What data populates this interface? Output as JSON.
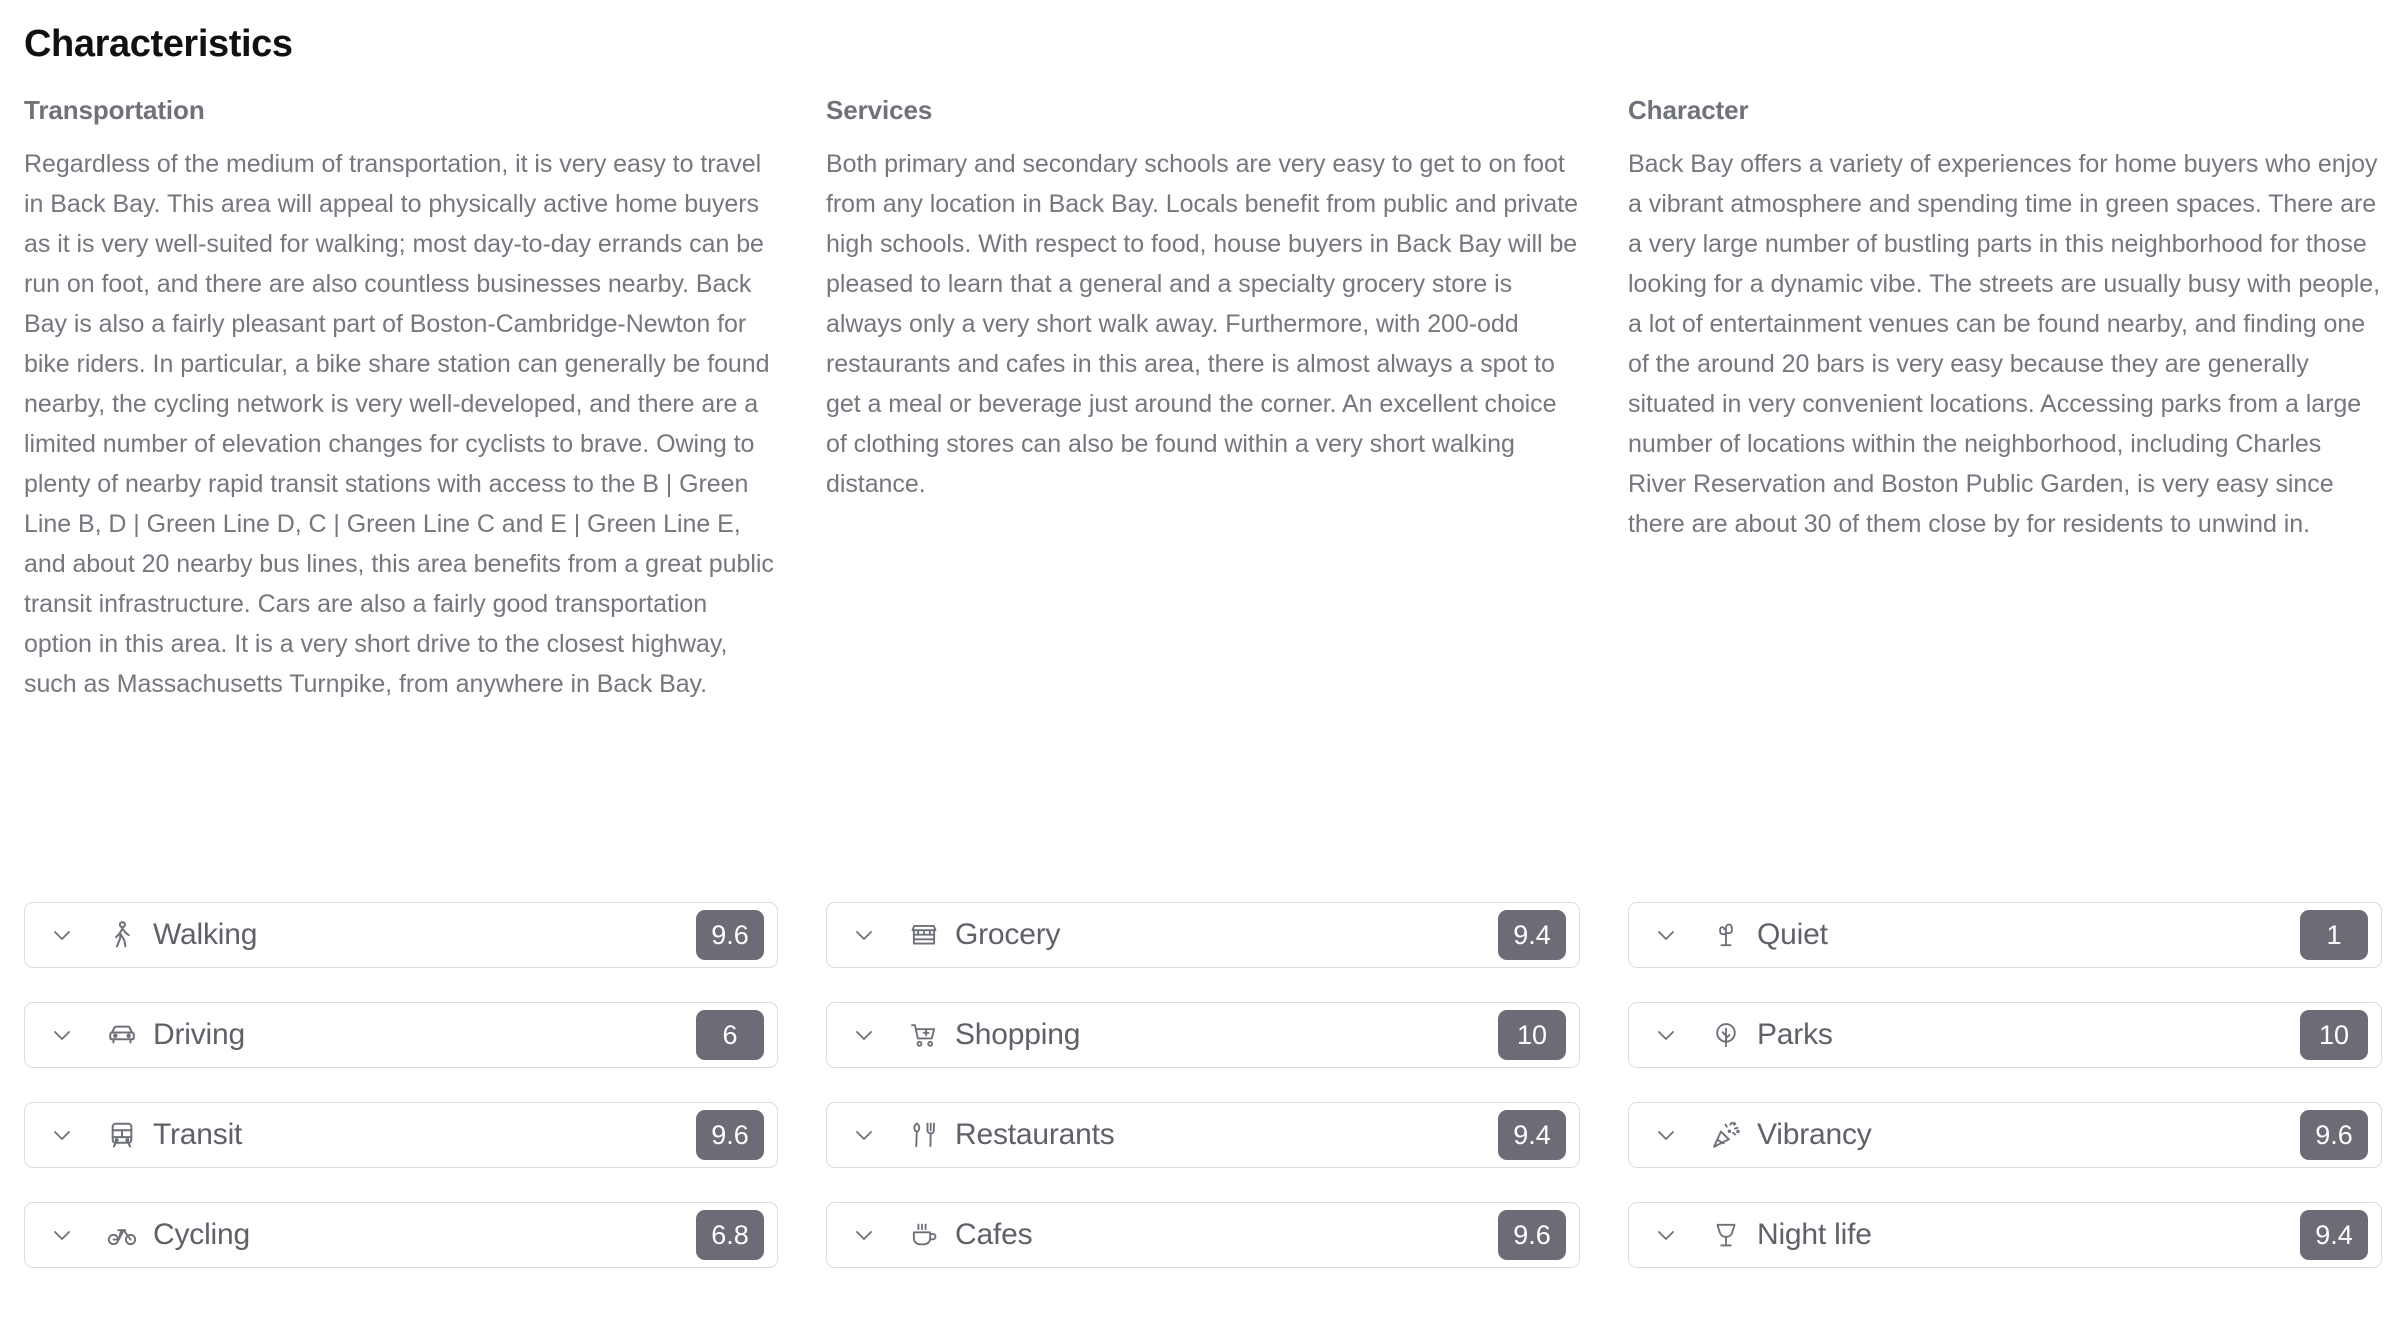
{
  "page_title": "Characteristics",
  "accent": {
    "badge_bg": "#6b6c76",
    "badge_text": "#ffffff",
    "card_border": "#dddde1",
    "body_text": "#75777e",
    "heading_text": "#70727a",
    "title_text": "#111111"
  },
  "columns": [
    {
      "title": "Transportation",
      "body": "Regardless of the medium of transportation, it is very easy to travel in Back Bay. This area will appeal to physically active home buyers as it is very well-suited for walking; most day-to-day errands can be run on foot, and there are also countless businesses nearby. Back Bay is also a fairly pleasant part of Boston-Cambridge-Newton for bike riders. In particular, a bike share station can generally be found nearby, the cycling network is very well-developed, and there are a limited number of elevation changes for cyclists to brave. Owing to plenty of nearby rapid transit stations with access to the B | Green Line B, D | Green Line D, C | Green Line C and E | Green Line E, and about 20 nearby bus lines, this area benefits from a great public transit infrastructure. Cars are also a fairly good transportation option in this area. It is a very short drive to the closest highway, such as Massachusetts Turnpike, from anywhere in Back Bay.",
      "cards": [
        {
          "label": "Walking",
          "score": "9.6",
          "icon": "walking-icon",
          "chevron": "chevron-down-icon"
        },
        {
          "label": "Driving",
          "score": "6",
          "icon": "car-icon",
          "chevron": "chevron-down-icon"
        },
        {
          "label": "Transit",
          "score": "9.6",
          "icon": "bus-icon",
          "chevron": "chevron-down-icon"
        },
        {
          "label": "Cycling",
          "score": "6.8",
          "icon": "bicycle-icon",
          "chevron": "chevron-down-icon"
        }
      ]
    },
    {
      "title": "Services",
      "body": "Both primary and secondary schools are very easy to get to on foot from any location in Back Bay. Locals benefit from public and private high schools. With respect to food, house buyers in Back Bay will be pleased to learn that a general and a specialty grocery store is always only a very short walk away. Furthermore, with 200-odd restaurants and cafes in this area, there is almost always a spot to get a meal or beverage just around the corner. An excellent choice of clothing stores can also be found within a very short walking distance.",
      "cards": [
        {
          "label": "Grocery",
          "score": "9.4",
          "icon": "store-icon",
          "chevron": "chevron-down-icon"
        },
        {
          "label": "Shopping",
          "score": "10",
          "icon": "shopping-cart-icon",
          "chevron": "chevron-down-icon"
        },
        {
          "label": "Restaurants",
          "score": "9.4",
          "icon": "fork-knife-icon",
          "chevron": "chevron-down-icon"
        },
        {
          "label": "Cafes",
          "score": "9.6",
          "icon": "coffee-cup-icon",
          "chevron": "chevron-down-icon"
        }
      ]
    },
    {
      "title": "Character",
      "body": "Back Bay offers a variety of experiences for home buyers who enjoy a vibrant atmosphere and spending time in green spaces. There are a very large number of bustling parts in this neighborhood for those looking for a dynamic vibe. The streets are usually busy with people, a lot of entertainment venues can be found nearby, and finding one of the around 20 bars is very easy because they are generally situated in very convenient locations. Accessing parks from a large number of locations within the neighborhood, including Charles River Reservation and Boston Public Garden, is very easy since there are about 30 of them close by for residents to unwind in.",
      "cards": [
        {
          "label": "Quiet",
          "score": "1",
          "icon": "cactus-icon",
          "chevron": "chevron-down-icon"
        },
        {
          "label": "Parks",
          "score": "10",
          "icon": "tree-icon",
          "chevron": "chevron-down-icon"
        },
        {
          "label": "Vibrancy",
          "score": "9.6",
          "icon": "party-popper-icon",
          "chevron": "chevron-down-icon"
        },
        {
          "label": "Night life",
          "score": "9.4",
          "icon": "wine-glass-icon",
          "chevron": "chevron-down-icon"
        }
      ]
    }
  ]
}
